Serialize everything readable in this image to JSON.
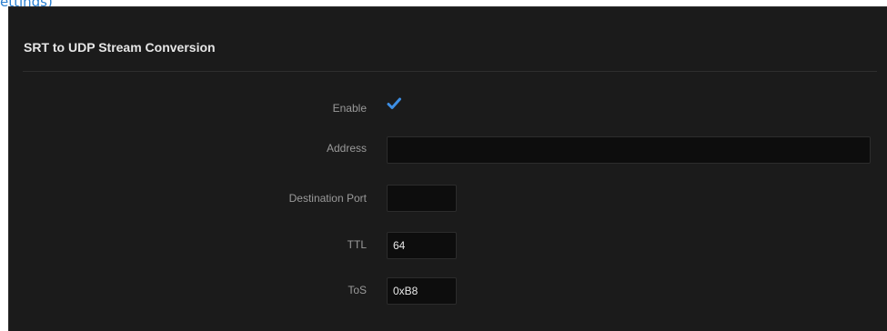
{
  "page": {
    "top_link_fragment": "ettings)"
  },
  "panel": {
    "title": "SRT to UDP Stream Conversion"
  },
  "form": {
    "enable": {
      "label": "Enable",
      "checked": true
    },
    "address": {
      "label": "Address",
      "value": ""
    },
    "destination_port": {
      "label": "Destination Port",
      "value": ""
    },
    "ttl": {
      "label": "TTL",
      "value": "64"
    },
    "tos": {
      "label": "ToS",
      "value": "0xB8"
    }
  },
  "colors": {
    "panel_background": "#1b1b1b",
    "field_background": "#0d0d0d",
    "checkbox_accent": "#3d8ee3",
    "link": "#2a7fd0"
  }
}
